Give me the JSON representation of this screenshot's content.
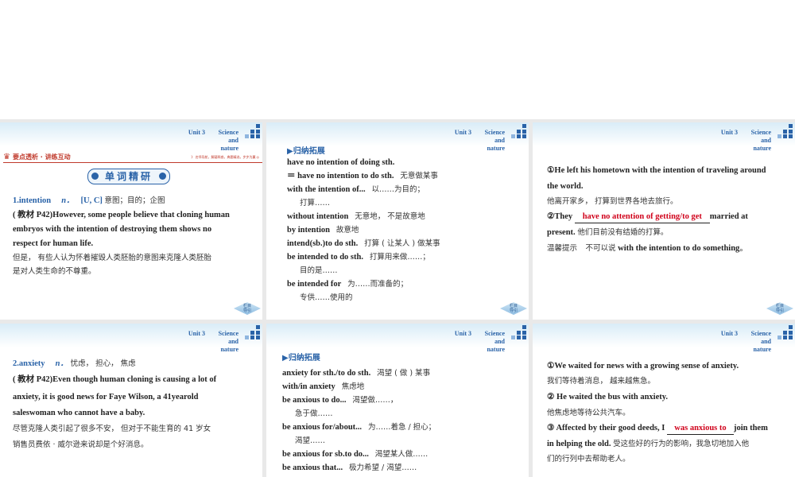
{
  "header": {
    "unit": "Unit 3",
    "topic_line1": "Science and",
    "topic_line2": "nature"
  },
  "back_button": {
    "line1": "栏目",
    "line2": "导引"
  },
  "slide1": {
    "banner": "要点透析 · 讲练互动",
    "banner_sub": "》 名师导航，解疑释惑，典题精选，步步为赢 ◎",
    "section_title": "单词精研",
    "entry_word": "1.intention",
    "entry_pos": "n．",
    "entry_gram": "[U, C]",
    "entry_meaning": "意图；目的；企图",
    "example_l1": "( 教材 P42)However, some people believe that cloning human",
    "example_l2": "embryos  with  the  intention  of  destroying  them  shows  no",
    "example_l3": "respect for human life.",
    "trans_l1": "但是， 有些人认为怀着摧毁人类胚胎的意图来克隆人类胚胎",
    "trans_l2": "是对人类生命的不尊重。"
  },
  "slide2": {
    "heading": "▶归纳拓展",
    "items": [
      {
        "en": "have no intention of doing sth.",
        "zh": ""
      },
      {
        "en": "＝  have no intention to do sth.",
        "zh": "无意做某事"
      },
      {
        "en": "with the intention of...",
        "zh": "以……为目的；"
      },
      {
        "en": "",
        "zh": "打算……"
      },
      {
        "en": "without intention",
        "zh": "无意地， 不是故意地"
      },
      {
        "en": "by intention",
        "zh": "故意地"
      },
      {
        "en": "intend(sb.)to do sth.",
        "zh": "打算 ( 让某人 ) 做某事"
      },
      {
        "en": "be intended to do sth.",
        "zh": "打算用来做……；"
      },
      {
        "en": "",
        "zh": "目的是……"
      },
      {
        "en": "be intended for",
        "zh": "为……而准备的；"
      },
      {
        "en": "",
        "zh": "专供……使用的"
      }
    ]
  },
  "slide3": {
    "ex1_l1": "①He left his hometown with the intention of traveling around",
    "ex1_l2": "the world.",
    "ex1_zh": "他离开家乡， 打算到世界各地去旅行。",
    "ex2_pre": "②They ",
    "ex2_answer": "have no attention of getting/to get",
    "ex2_post": "married at",
    "ex2_l2": "present.",
    "ex2_zh": "他们目前没有结婚的打算。",
    "tip_label": "温馨提示",
    "tip_zh": "不可以说",
    "tip_en": "with the intention to do something",
    "tip_end": "。"
  },
  "slide4": {
    "entry_word": "2.anxiety",
    "entry_pos": "n．",
    "entry_meaning": "忧虑， 担心， 焦虑",
    "example_l1": "( 教材 P42)Even though human cloning is causing a lot of",
    "example_l2": "anxiety, it is good news for Faye Wilson, a 41yearold",
    "example_l3": "saleswoman who cannot have a baby.",
    "trans_l1": "尽管克隆人类引起了很多不安， 但对于不能生育的 41 岁女",
    "trans_l2": "销售员费依 · 威尔逊来说却是个好消息。"
  },
  "slide5": {
    "heading": "▶归纳拓展",
    "items": [
      {
        "en": "anxiety for sth./to do sth.",
        "zh": "渴望 ( 做 ) 某事"
      },
      {
        "en": "with/in anxiety",
        "zh": "焦虑地"
      },
      {
        "en": "be anxious to do...",
        "zh": "渴望做……，"
      },
      {
        "en": "",
        "zh": "急于做……"
      },
      {
        "en": "be anxious for/about...",
        "zh": "为……着急 / 担心；"
      },
      {
        "en": "",
        "zh": "渴望……"
      },
      {
        "en": "be anxious for sb.to do...",
        "zh": "渴望某人做……"
      },
      {
        "en": "be anxious that...",
        "zh": "极力希望 / 渴望……"
      }
    ]
  },
  "slide6": {
    "ex1_en": "①We waited for news with a growing sense of anxiety.",
    "ex1_zh": "我们等待着消息， 越来越焦急。",
    "ex2_en": "② He waited the bus with anxiety.",
    "ex2_zh": "他焦虑地等待公共汽车。",
    "ex3_pre": "③ Affected by their good deeds, I ",
    "ex3_answer": "was anxious to",
    "ex3_post": "join them",
    "ex3_l2": "in helping the old.",
    "ex3_l2_zh": "受这些好的行为的影响，我急切地加入他",
    "ex3_zh2": "们的行列中去帮助老人。"
  }
}
